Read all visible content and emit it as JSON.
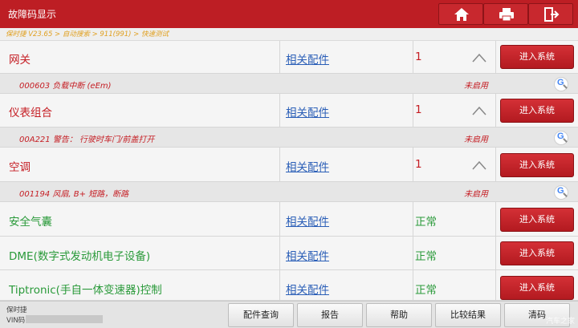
{
  "header": {
    "title": "故障码显示",
    "breadcrumb": "保时捷 V23.65 > 自动搜索 > 911(991) > 快速测试",
    "buttons": [
      "home-icon",
      "print-icon",
      "exit-icon"
    ]
  },
  "parts_label": "相关配件",
  "enter_label": "进入系统",
  "modules": [
    {
      "name": "网关",
      "status": "1",
      "faulty": true,
      "dtc": {
        "code": "000603 负载中断 (eEm)",
        "state": "未启用"
      }
    },
    {
      "name": "仪表组合",
      "status": "1",
      "faulty": true,
      "dtc": {
        "code": "00A221 警告： 行驶时车门/前盖打开",
        "state": "未启用"
      }
    },
    {
      "name": "空调",
      "status": "1",
      "faulty": true,
      "dtc": {
        "code": "001194 风扇, B+ 短路，断路",
        "state": "未启用"
      }
    },
    {
      "name": "安全气囊",
      "status": "正常",
      "faulty": false
    },
    {
      "name": "DME(数字式发动机电子设备)",
      "status": "正常",
      "faulty": false
    },
    {
      "name": "Tiptronic(手自一体变速器)控制",
      "status": "正常",
      "faulty": false
    }
  ],
  "footer": {
    "make": "保时捷",
    "vin_label": "VIN码",
    "buttons": [
      "配件查询",
      "报告",
      "帮助",
      "比较结果",
      "清码"
    ]
  },
  "watermark": "汽车之家",
  "colors": {
    "header": "#bd1e24",
    "fault": "#c51d23",
    "ok": "#2a9a3a",
    "link": "#2a5eb7"
  }
}
